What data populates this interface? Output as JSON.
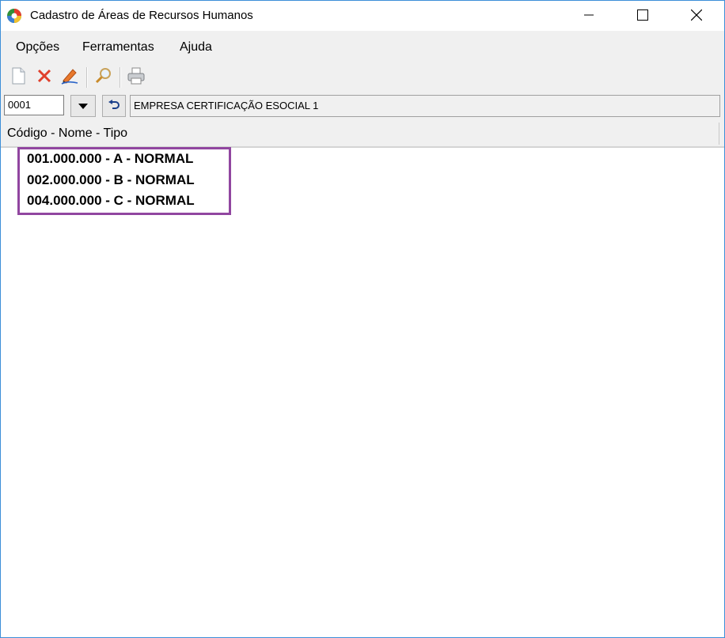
{
  "window": {
    "title": "Cadastro de Áreas de Recursos Humanos",
    "icon": "rh-app-icon",
    "controls": [
      "minimize-icon",
      "maximize-icon",
      "close-icon"
    ]
  },
  "menu": {
    "items": [
      {
        "label": "Opções"
      },
      {
        "label": "Ferramentas"
      },
      {
        "label": "Ajuda"
      }
    ]
  },
  "toolbar": {
    "buttons": [
      "new-document-icon",
      "delete-icon",
      "edit-pencil-icon",
      "search-magnifier-icon",
      "print-icon"
    ]
  },
  "filter": {
    "company_code": "0001",
    "company_name": "EMPRESA CERTIFICAÇÃO ESOCIAL 1"
  },
  "list": {
    "header": "Código - Nome - Tipo",
    "rows": [
      {
        "text": "001.000.000 - A - NORMAL"
      },
      {
        "text": "002.000.000 - B - NORMAL"
      },
      {
        "text": "004.000.000 - C - NORMAL"
      }
    ],
    "highlight_color": "#9146a0"
  }
}
